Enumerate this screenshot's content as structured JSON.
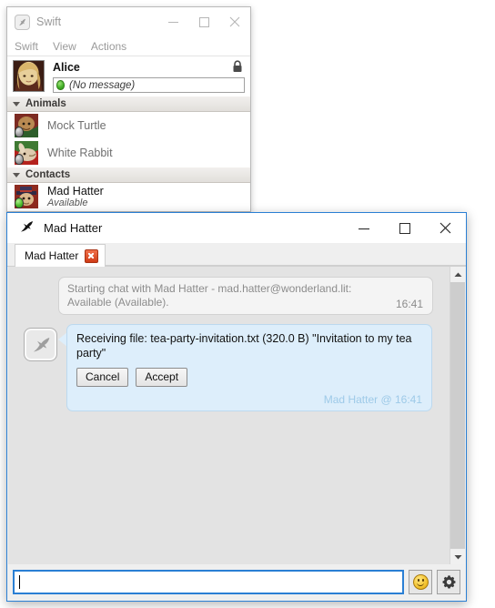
{
  "roster_window": {
    "title": "Swift",
    "app_icon": "swift-bird-icon",
    "window_buttons": {
      "minimize": "minimize-icon",
      "maximize": "maximize-icon",
      "close": "close-icon"
    },
    "menu": [
      "Swift",
      "View",
      "Actions"
    ],
    "self": {
      "name": "Alice",
      "avatar": "alice-avatar",
      "lock_icon": "lock-icon",
      "status_icon": "status-online-icon",
      "status_message": "(No message)"
    },
    "groups": [
      {
        "label": "Animals",
        "expanded": true,
        "contacts": [
          {
            "name": "Mock Turtle",
            "presence": "offline"
          },
          {
            "name": "White Rabbit",
            "presence": "offline"
          }
        ]
      },
      {
        "label": "Contacts",
        "expanded": true,
        "contacts": [
          {
            "name": "Mad Hatter",
            "presence": "online",
            "status": "Available"
          }
        ]
      }
    ]
  },
  "chat_window": {
    "title": "Mad Hatter",
    "app_icon": "swift-bird-icon",
    "window_buttons": {
      "minimize": "minimize-icon",
      "maximize": "maximize-icon",
      "close": "close-icon"
    },
    "tabs": [
      {
        "label": "Mad Hatter",
        "close_icon": "tab-close-icon",
        "active": true
      }
    ],
    "system_message": {
      "line1": "Starting chat with Mad Hatter - mad.hatter@wonderland.lit:",
      "line2": "Available (Available).",
      "time": "16:41"
    },
    "file_transfer": {
      "avatar": "swift-default-avatar",
      "text": "Receiving file: tea-party-invitation.txt (320.0 B) \"Invitation to my tea party\"",
      "buttons": [
        "Cancel",
        "Accept"
      ],
      "meta": "Mad Hatter @ 16:41"
    },
    "scrollbar": {
      "up_icon": "chevron-up-icon",
      "down_icon": "chevron-down-icon"
    },
    "composer": {
      "value": "",
      "placeholder": "",
      "emoji_icon": "smiley-icon",
      "settings_icon": "gear-icon"
    }
  },
  "colors": {
    "accent": "#2a7fd4",
    "bubble_bg": "#ddeefb",
    "bubble_border": "#bcd9ef",
    "meta_text": "#9ecae8",
    "chat_bg": "#e3e3e3",
    "tab_close": "#cf3b16"
  }
}
